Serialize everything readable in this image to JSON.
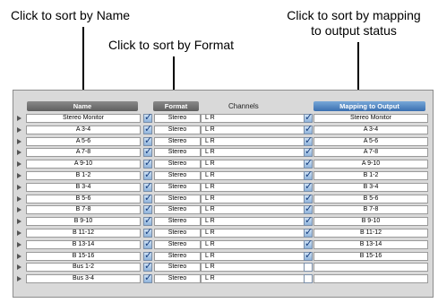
{
  "callouts": {
    "name": "Click to sort by Name",
    "format": "Click to sort by Format",
    "mapping_line1": "Click to sort by mapping",
    "mapping_line2": "to output status"
  },
  "headers": {
    "name": "Name",
    "format": "Format",
    "channels": "Channels",
    "mapping": "Mapping to Output"
  },
  "rows": [
    {
      "name": "Stereo Monitor",
      "checked": true,
      "format": "Stereo",
      "channels": "L  R",
      "map_checked": true,
      "mapping": "Stereo Monitor"
    },
    {
      "name": "A 3-4",
      "checked": true,
      "format": "Stereo",
      "channels": "L  R",
      "map_checked": true,
      "mapping": "A 3-4"
    },
    {
      "name": "A 5-6",
      "checked": true,
      "format": "Stereo",
      "channels": "L  R",
      "map_checked": true,
      "mapping": "A 5-6"
    },
    {
      "name": "A 7-8",
      "checked": true,
      "format": "Stereo",
      "channels": "L  R",
      "map_checked": true,
      "mapping": "A 7-8"
    },
    {
      "name": "A 9-10",
      "checked": true,
      "format": "Stereo",
      "channels": "L  R",
      "map_checked": true,
      "mapping": "A 9-10"
    },
    {
      "name": "B 1-2",
      "checked": true,
      "format": "Stereo",
      "channels": "L  R",
      "map_checked": true,
      "mapping": "B 1-2"
    },
    {
      "name": "B 3-4",
      "checked": true,
      "format": "Stereo",
      "channels": "L  R",
      "map_checked": true,
      "mapping": "B 3-4"
    },
    {
      "name": "B 5-6",
      "checked": true,
      "format": "Stereo",
      "channels": "L  R",
      "map_checked": true,
      "mapping": "B 5-6"
    },
    {
      "name": "B 7-8",
      "checked": true,
      "format": "Stereo",
      "channels": "L  R",
      "map_checked": true,
      "mapping": "B 7-8"
    },
    {
      "name": "B 9-10",
      "checked": true,
      "format": "Stereo",
      "channels": "L  R",
      "map_checked": true,
      "mapping": "B 9-10"
    },
    {
      "name": "B 11-12",
      "checked": true,
      "format": "Stereo",
      "channels": "L  R",
      "map_checked": true,
      "mapping": "B 11-12"
    },
    {
      "name": "B 13-14",
      "checked": true,
      "format": "Stereo",
      "channels": "L  R",
      "map_checked": true,
      "mapping": "B 13-14"
    },
    {
      "name": "B 15-16",
      "checked": true,
      "format": "Stereo",
      "channels": "L  R",
      "map_checked": true,
      "mapping": "B 15-16"
    },
    {
      "name": "Bus 1-2",
      "checked": true,
      "format": "Stereo",
      "channels": "L  R",
      "map_checked": false,
      "mapping": ""
    },
    {
      "name": "Bus 3-4",
      "checked": true,
      "format": "Stereo",
      "channels": "L  R",
      "map_checked": false,
      "mapping": ""
    }
  ],
  "colors": {
    "panel": "#d9d9d9",
    "header_gray": "#6e6e6e",
    "header_blue": "#4a80c0"
  }
}
